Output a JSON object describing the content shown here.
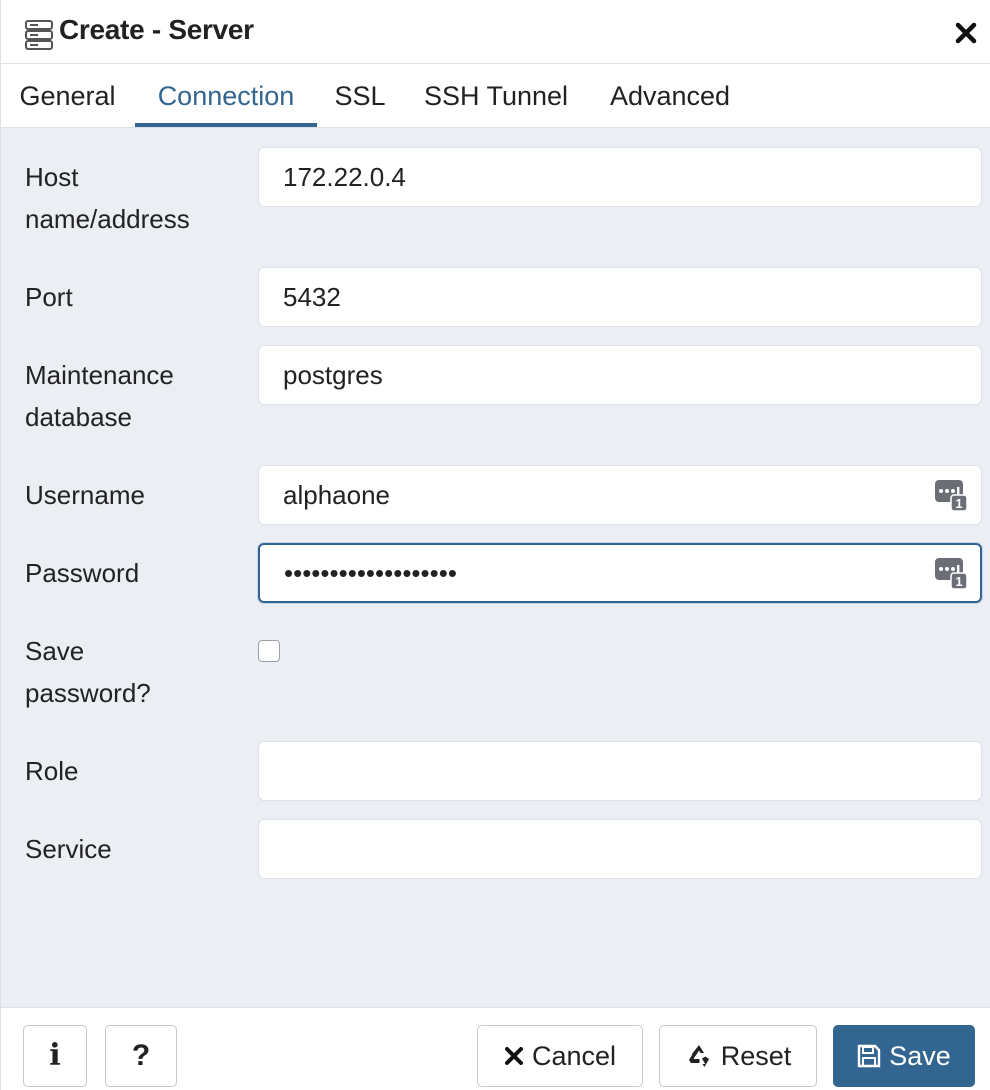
{
  "dialog": {
    "title": "Create - Server",
    "title_icon": "server-icon",
    "close_icon": "close-icon"
  },
  "tabs": [
    {
      "label": "General",
      "active": false
    },
    {
      "label": "Connection",
      "active": true
    },
    {
      "label": "SSL",
      "active": false
    },
    {
      "label": "SSH Tunnel",
      "active": false
    },
    {
      "label": "Advanced",
      "active": false
    }
  ],
  "form": {
    "host": {
      "label_line1": "Host",
      "label_line2": "name/address",
      "value": "172.22.0.4"
    },
    "port": {
      "label": "Port",
      "value": "5432"
    },
    "maintenance_db": {
      "label_line1": "Maintenance",
      "label_line2": "database",
      "value": "postgres"
    },
    "username": {
      "label": "Username",
      "value": "alphaone",
      "icon": "password-manager-icon"
    },
    "password": {
      "label": "Password",
      "value": "•••••••••••••••••••",
      "icon": "password-manager-icon"
    },
    "save_password": {
      "label_line1": "Save",
      "label_line2": "password?",
      "checked": false
    },
    "role": {
      "label": "Role",
      "value": ""
    },
    "service": {
      "label": "Service",
      "value": ""
    }
  },
  "footer": {
    "info_label": "i",
    "help_label": "?",
    "cancel_label": "Cancel",
    "reset_label": "Reset",
    "save_label": "Save"
  },
  "colors": {
    "accent": "#326690",
    "body_bg": "#ebeef3",
    "border": "#dde0e6"
  }
}
